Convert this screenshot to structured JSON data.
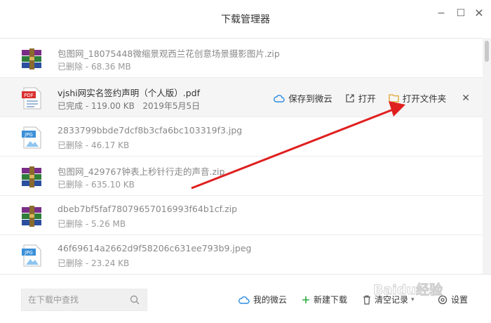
{
  "window": {
    "title": "下载管理器",
    "minimize_glyph": "−",
    "maximize_glyph": "☐",
    "close_glyph": "✕"
  },
  "downloads": [
    {
      "icon": "zip-archive-icon",
      "name": "包图网_18075448微缩景观西兰花创意场景摄影图片.zip",
      "status": "已删除",
      "size": "68.36 MB",
      "date": ""
    },
    {
      "icon": "pdf-file-icon",
      "name": "vjshi网实名签约声明（个人版）.pdf",
      "status": "已完成",
      "size": "119.00 KB",
      "date": "2019年5月5日"
    },
    {
      "icon": "jpg-image-icon",
      "name": "2833799bbde7dcf8b3cfa6bc103319f3.jpg",
      "status": "已删除",
      "size": "46.17 KB",
      "date": ""
    },
    {
      "icon": "zip-archive-icon",
      "name": "包图网_429767钟表上秒针行走的声音.zip",
      "status": "已删除",
      "size": "635.10 KB",
      "date": ""
    },
    {
      "icon": "zip-archive-icon",
      "name": "dbeb7bf5faf78079657016993f64b1cf.zip",
      "status": "已删除",
      "size": "5.26 MB",
      "date": ""
    },
    {
      "icon": "jpg-image-icon",
      "name": "46f69614a2662d9f58206c631ee793b9.jpeg",
      "status": "已删除",
      "size": "23.24 KB",
      "date": ""
    }
  ],
  "file_icon_labels": {
    "pdf": "PDF",
    "jpg": "JPG"
  },
  "meta_separator": " - ",
  "row_actions": {
    "save_to_cloud": "保存到微云",
    "open": "打开",
    "open_folder": "打开文件夹",
    "remove_glyph": "✕"
  },
  "footer": {
    "search_placeholder": "在下载中查找",
    "my_cloud": "我的微云",
    "new_download": "新建下载",
    "clear_records": "清空记录",
    "settings": "设置"
  },
  "colors": {
    "annotation_arrow": "#e02020",
    "new_download_plus": "#2bab3f",
    "cloud_icon": "#2a8be0",
    "folder_icon": "#f4c04a"
  },
  "watermark": {
    "text": "Baidu经验"
  }
}
